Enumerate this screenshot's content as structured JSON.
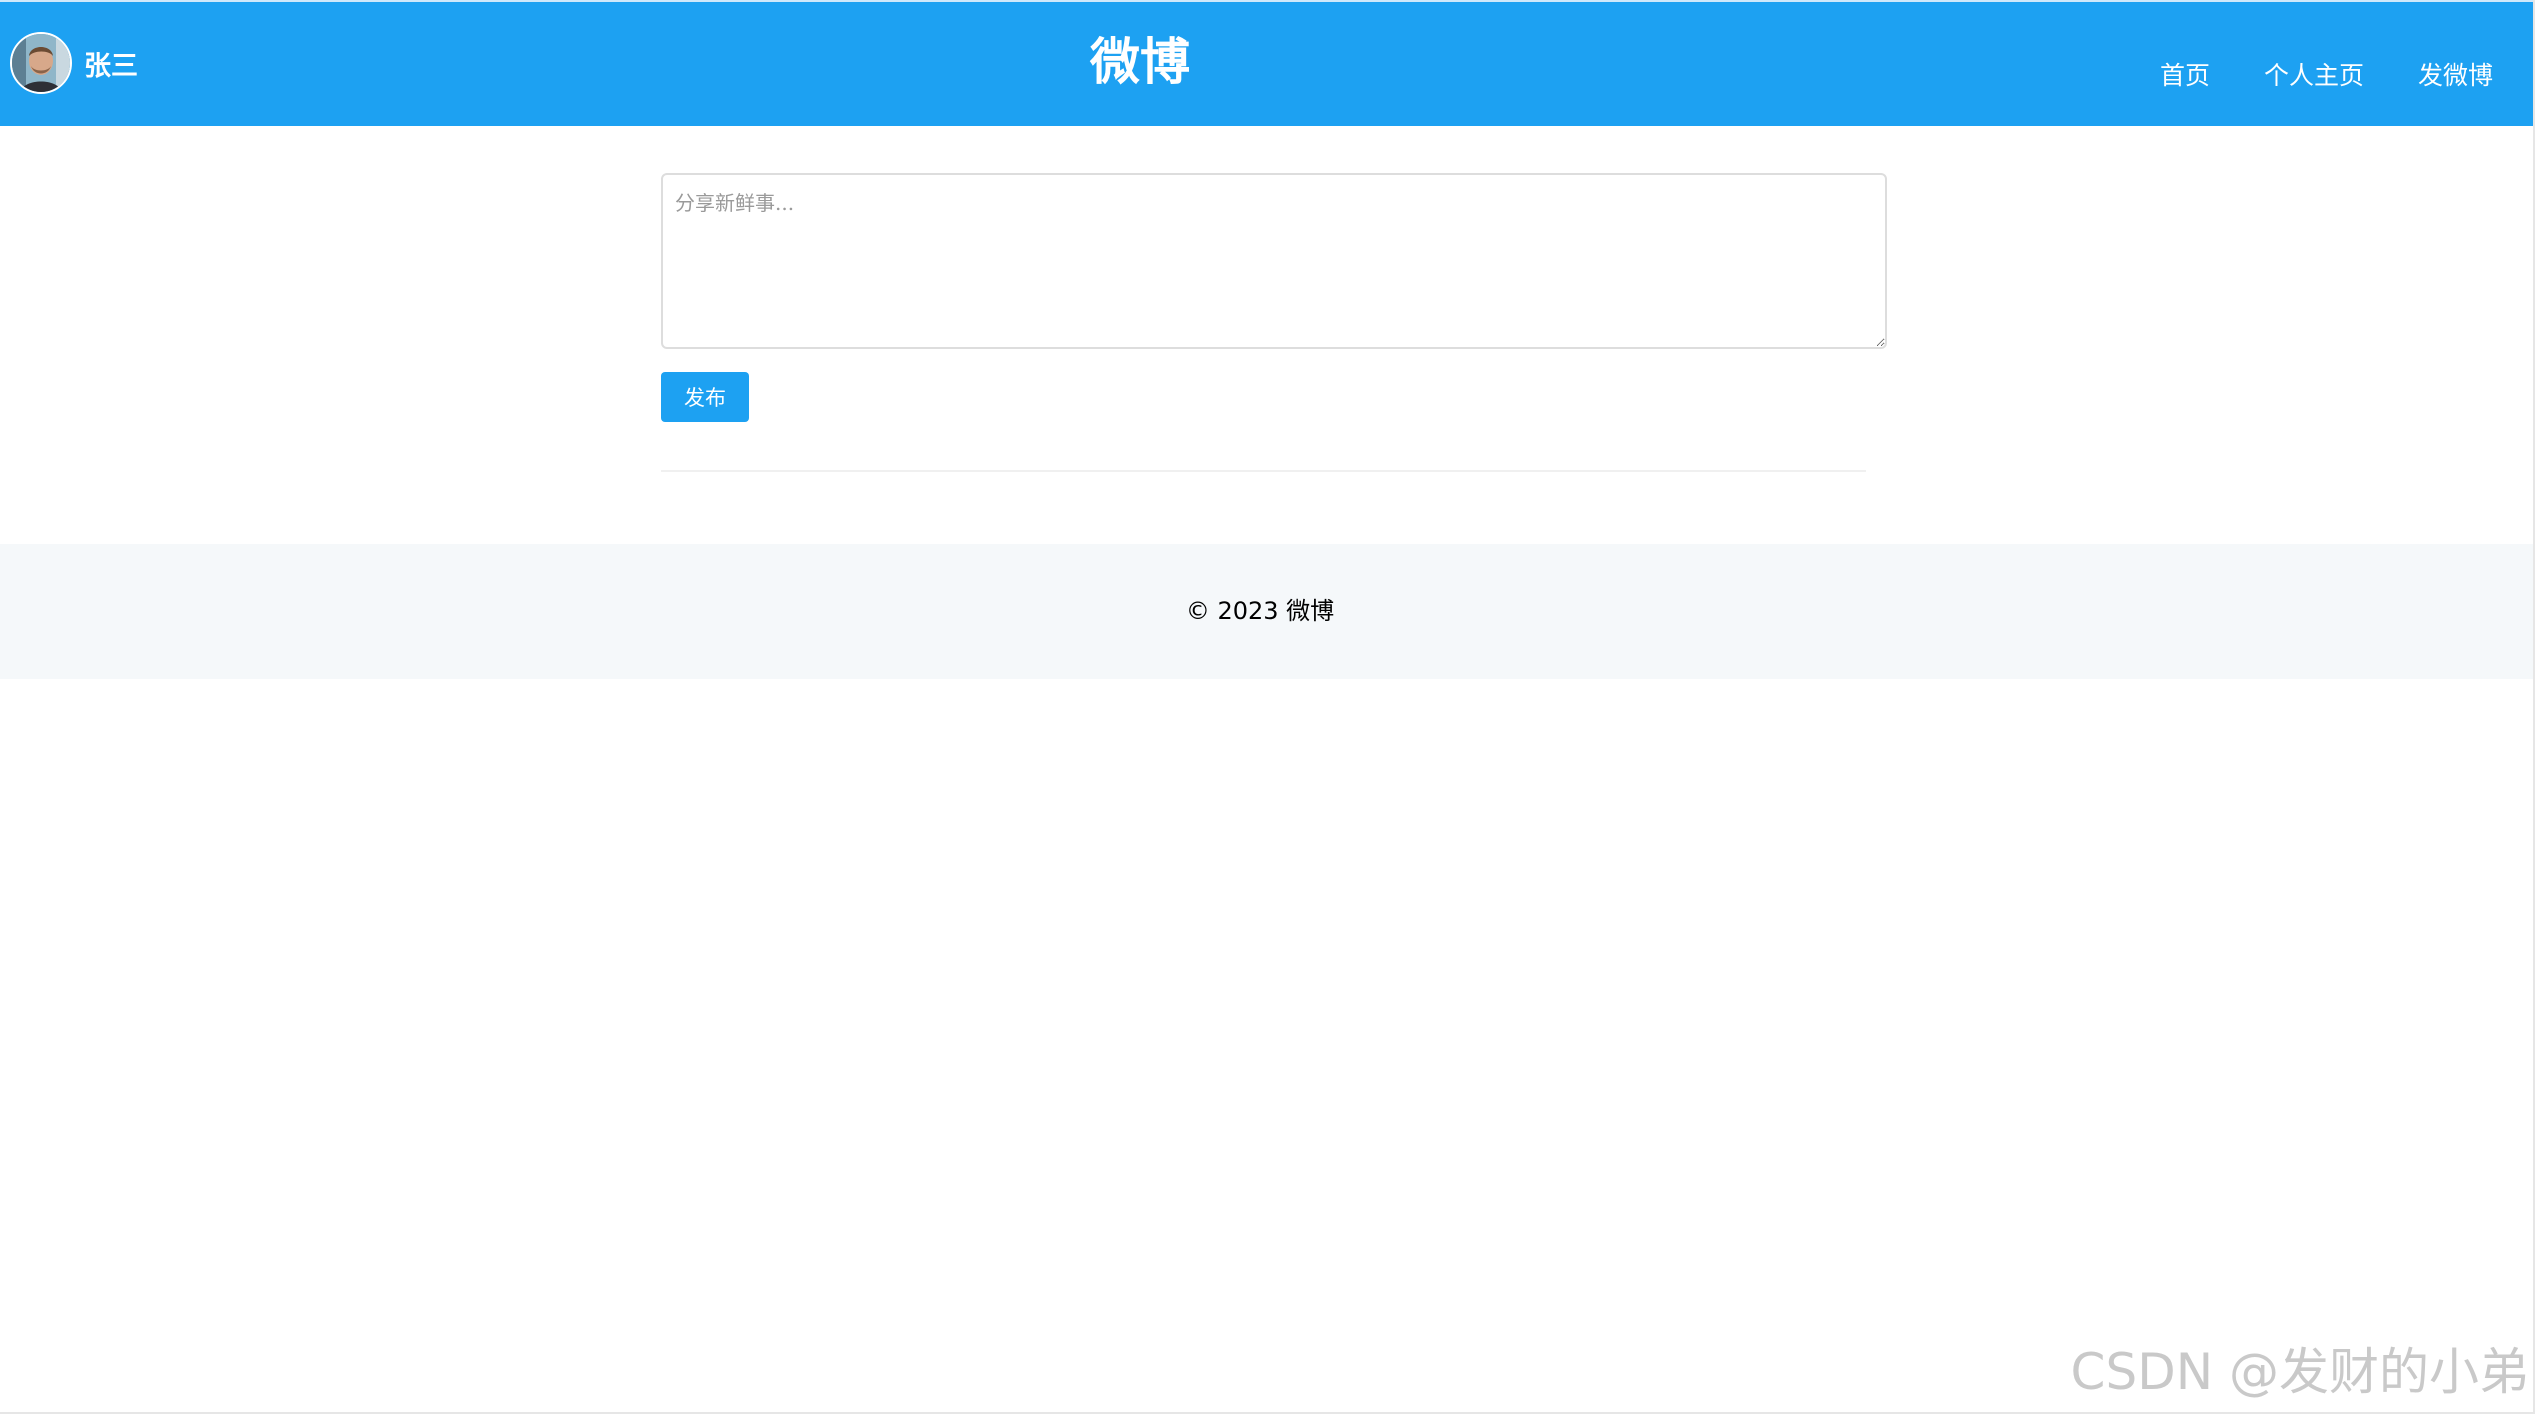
{
  "header": {
    "user_name": "张三",
    "site_title": "微博",
    "nav": {
      "home": "首页",
      "profile": "个人主页",
      "post": "发微博"
    }
  },
  "composer": {
    "placeholder": "分享新鲜事...",
    "value": "",
    "publish_label": "发布"
  },
  "footer": {
    "copyright": "© 2023 微博"
  },
  "watermark": "CSDN @发财的小弟",
  "colors": {
    "brand": "#1da1f2",
    "footer_bg": "#f5f8fa"
  }
}
